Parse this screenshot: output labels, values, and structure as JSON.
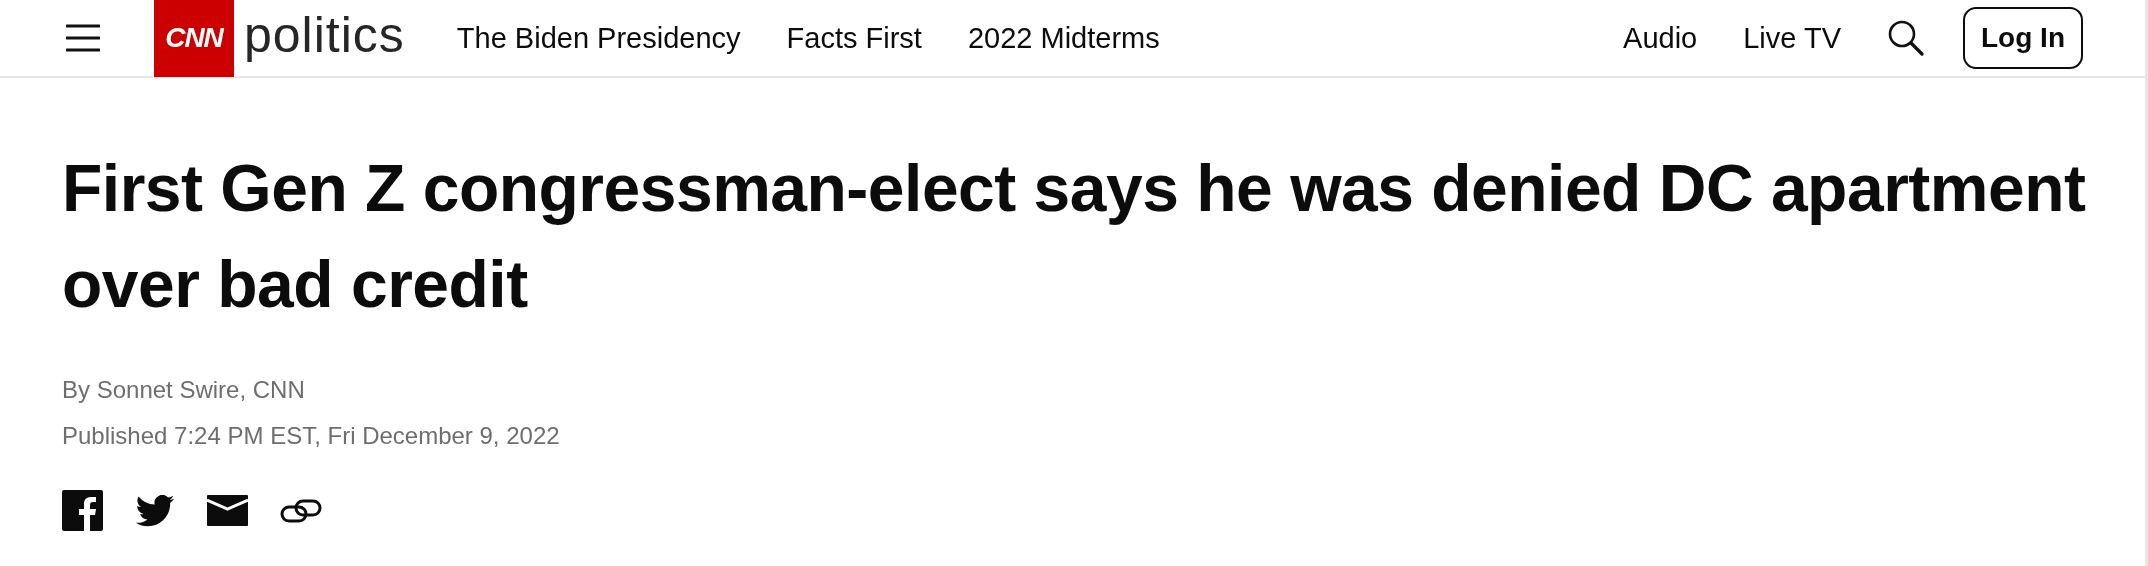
{
  "header": {
    "logo": {
      "brand": "CNN",
      "section": "politics"
    },
    "nav": [
      "The Biden Presidency",
      "Facts First",
      "2022 Midterms"
    ],
    "right_links": [
      "Audio",
      "Live TV"
    ],
    "login": "Log In"
  },
  "article": {
    "headline": "First Gen Z congressman-elect says he was denied DC apartment over bad credit",
    "byline": "By Sonnet Swire, CNN",
    "published": "Published 7:24 PM EST, Fri December 9, 2022",
    "share": [
      {
        "kind": "facebook"
      },
      {
        "kind": "twitter"
      },
      {
        "kind": "email"
      },
      {
        "kind": "link"
      }
    ]
  }
}
